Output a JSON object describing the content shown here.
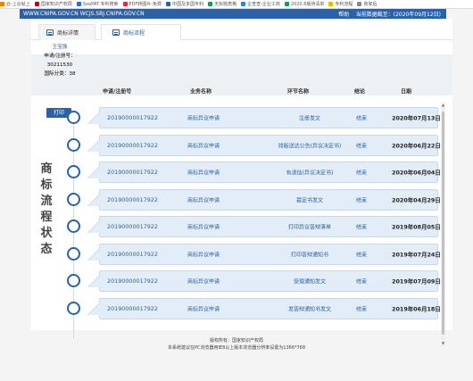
{
  "bookmarks": [
    {
      "label": "云-上云就上",
      "color": "#ff7a00"
    },
    {
      "label": "国家知识产权局",
      "color": "#c00000"
    },
    {
      "label": "SooPAT 专利搜索",
      "color": "#1a73e8"
    },
    {
      "label": "PDF转图片-免费",
      "color": "#d9342b"
    },
    {
      "label": "中国及多国专利",
      "color": "#2a62a8"
    },
    {
      "label": "无标题表格",
      "color": "#0f9d58"
    },
    {
      "label": "企查查-企业工商",
      "color": "#1e88e5"
    },
    {
      "label": "2020.6版待清单",
      "color": "#0f9d58"
    },
    {
      "label": "专利流程",
      "color": "#f4b400"
    },
    {
      "label": "商家后",
      "color": "#888888"
    }
  ],
  "topbar": {
    "site": "WWW.CNIPA.GOV.CN WCJS.SBJ.CNIPA.GOV.CN",
    "help": "帮助",
    "data_date": "当前数据截至：(2020年09月12日)"
  },
  "tabs": [
    {
      "label": "商标详情",
      "active": false
    },
    {
      "label": "商标流程",
      "active": true
    }
  ],
  "applicant": {
    "name": "王宝强",
    "reg_no": "申请/注册号：30211530",
    "class": "国际分类：38"
  },
  "headers": {
    "reg_no": "申请/注册号",
    "business": "业务名称",
    "step": "环节名称",
    "result": "结论",
    "date": "日期"
  },
  "print_label": "打印",
  "side_title": [
    "商",
    "标",
    "流",
    "程",
    "状",
    "态"
  ],
  "rows": [
    {
      "reg_no": "20190000017922",
      "business": "商标异议申请",
      "step": "注册发文",
      "result": "结束",
      "date": "2020年07月13日"
    },
    {
      "reg_no": "20190000017922",
      "business": "商标异议申请",
      "step": "排版送达公告(异议决定书)",
      "result": "结束",
      "date": "2020年06月22日"
    },
    {
      "reg_no": "20190000017922",
      "business": "商标异议申请",
      "step": "有退信(异议决定书)",
      "result": "结束",
      "date": "2020年06月04日"
    },
    {
      "reg_no": "20190000017922",
      "business": "商标异议申请",
      "step": "裁定书发文",
      "result": "结束",
      "date": "2020年04月29日"
    },
    {
      "reg_no": "20190000017922",
      "business": "商标异议申请",
      "step": "打印异议答辩清单",
      "result": "结束",
      "date": "2019年08月05日"
    },
    {
      "reg_no": "20190000017922",
      "business": "商标异议申请",
      "step": "打印答辩通知书",
      "result": "结束",
      "date": "2019年07月24日"
    },
    {
      "reg_no": "20190000017922",
      "business": "商标异议申请",
      "step": "受理通知发文",
      "result": "结束",
      "date": "2019年07月09日"
    },
    {
      "reg_no": "20190000017922",
      "business": "商标异议申请",
      "step": "发答辩通知书发文",
      "result": "结束",
      "date": "2019年06月18日"
    }
  ],
  "footer": {
    "line1": "版权所有：国家知识产权局",
    "line2": "本系统建议在PC浏览器用IE8以上版本浏览器分辨率设置为1366*768"
  }
}
